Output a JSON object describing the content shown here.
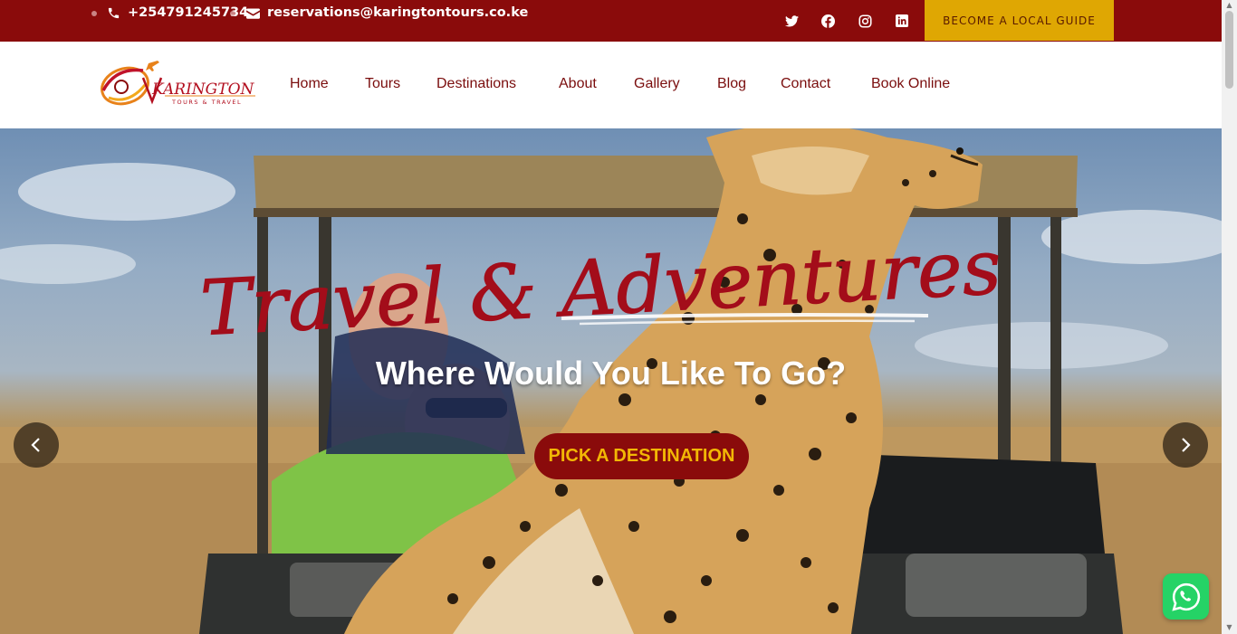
{
  "topbar": {
    "phone": "+254791245734",
    "email": "reservations@karingtontours.co.ke",
    "social_icons": [
      "twitter-icon",
      "facebook-icon",
      "instagram-icon",
      "linkedin-icon"
    ],
    "cta_label": "BECOME A LOCAL GUIDE"
  },
  "logo": {
    "name": "KARINGTON",
    "tagline": "TOURS & TRAVEL"
  },
  "nav": {
    "items": [
      "Home",
      "Tours",
      "Destinations",
      "About",
      "Gallery",
      "Blog",
      "Contact",
      "Book Online"
    ]
  },
  "hero": {
    "script_title": "Travel & Adventures",
    "headline": "Where Would You Like To Go?",
    "cta_label": "PICK A DESTINATION",
    "prev_icon": "chevron-left-icon",
    "next_icon": "chevron-right-icon"
  },
  "colors": {
    "brand_red": "#8a0b0b",
    "accent_gold": "#dfa703",
    "whatsapp_green": "#25d366"
  }
}
